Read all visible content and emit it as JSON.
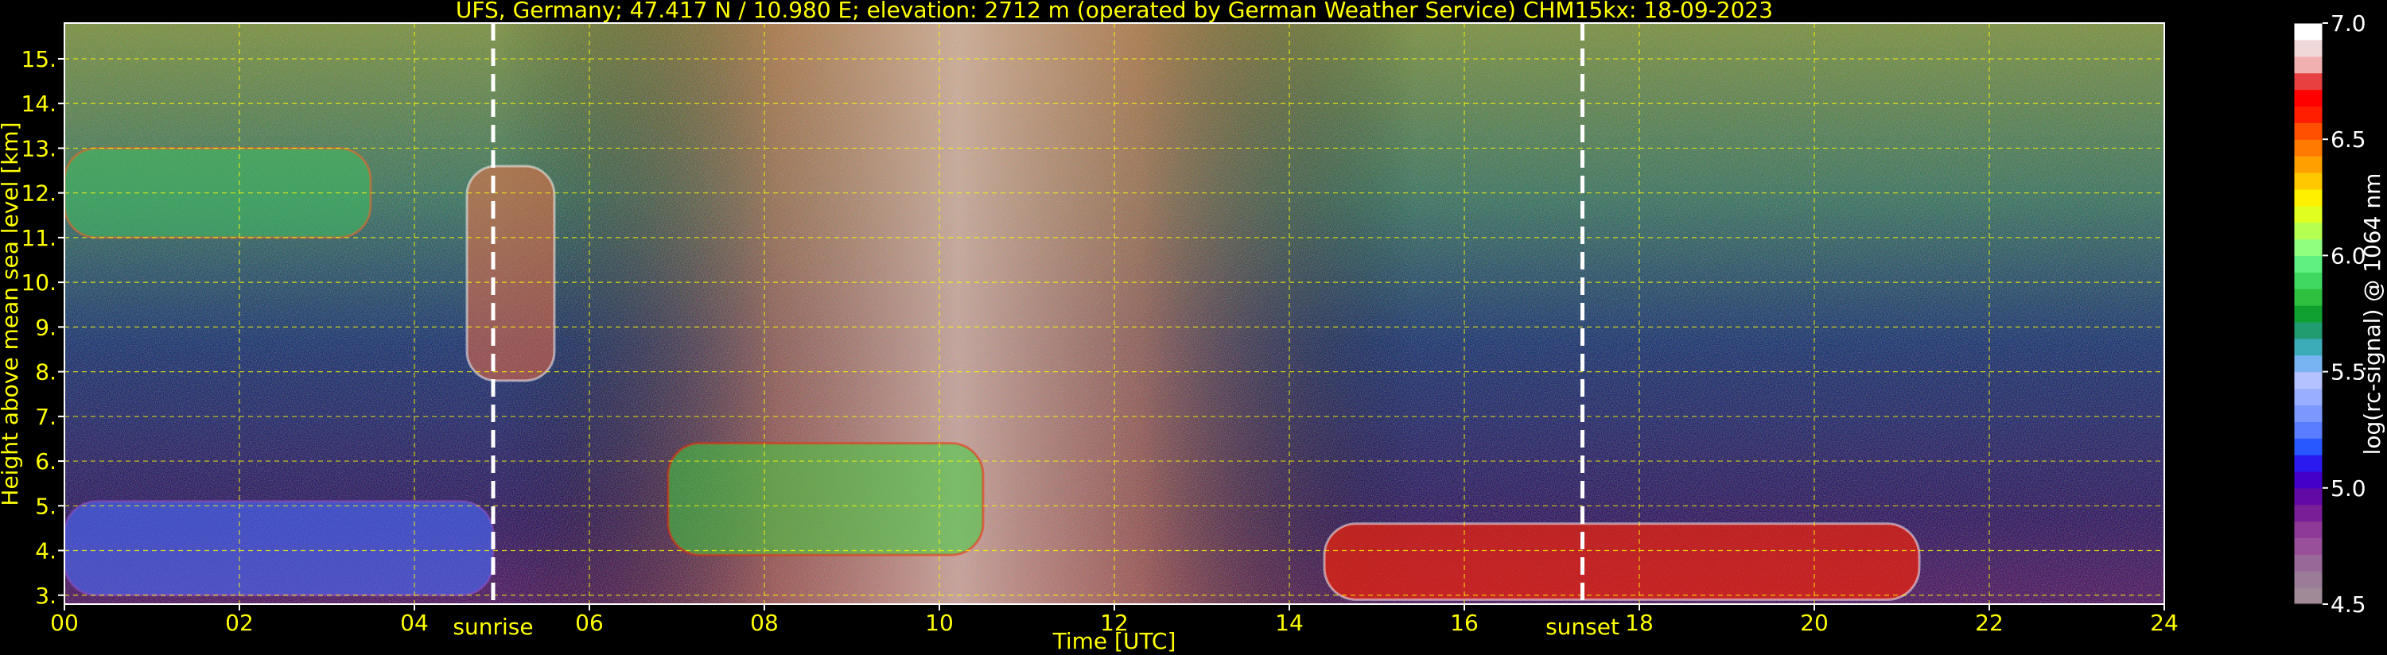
{
  "chart_data": {
    "type": "heatmap",
    "title": "UFS, Germany; 47.417 N / 10.980 E; elevation: 2712 m  (operated by German Weather Service)    CHM15kx: 18-09-2023",
    "xlabel": "Time [UTC]",
    "ylabel": "Height above mean sea level [km]",
    "xlim": [
      0,
      24
    ],
    "ylim": [
      2.8,
      15.8
    ],
    "xticks": [
      0,
      2,
      4,
      6,
      8,
      10,
      12,
      14,
      16,
      18,
      20,
      22,
      24
    ],
    "xtick_labels": [
      "00",
      "02",
      "04",
      "06",
      "08",
      "10",
      "12",
      "14",
      "16",
      "18",
      "20",
      "22",
      "24"
    ],
    "yticks": [
      3,
      4,
      5,
      6,
      7,
      8,
      9,
      10,
      11,
      12,
      13,
      14,
      15
    ],
    "ytick_labels": [
      "3.",
      "4.",
      "5.",
      "6.",
      "7.",
      "8.",
      "9.",
      "10.",
      "11.",
      "12.",
      "13.",
      "14.",
      "15."
    ],
    "grid": true,
    "annotations": [
      {
        "label": "sunrise",
        "x": 4.9
      },
      {
        "label": "sunset",
        "x": 17.35
      }
    ],
    "colorbar": {
      "label": "log(rc-signal) @ 1064 nm",
      "range": [
        4.5,
        7.0
      ],
      "ticks": [
        4.5,
        5.0,
        5.5,
        6.0,
        6.5,
        7.0
      ],
      "tick_labels": [
        "4.5",
        "5.0",
        "5.5",
        "6.0",
        "6.5",
        "7.0"
      ],
      "colors": [
        "#a08a98",
        "#9a7c98",
        "#986898",
        "#98509a",
        "#8e3a98",
        "#7a1e98",
        "#620aa6",
        "#4400c8",
        "#2a1af0",
        "#2858ff",
        "#5a7cff",
        "#7c98ff",
        "#9aaeff",
        "#b4c2ff",
        "#78b4f0",
        "#3cacb8",
        "#209c70",
        "#10a030",
        "#30c040",
        "#40d860",
        "#60f080",
        "#90ff80",
        "#b4ff50",
        "#e0ff20",
        "#fff000",
        "#ffc800",
        "#ffa000",
        "#ff7a00",
        "#ff5000",
        "#ff1e00",
        "#ff0000",
        "#e84040",
        "#f0b0b0",
        "#f0d8d8",
        "#ffffff"
      ]
    },
    "features": [
      {
        "kind": "cirrus",
        "x": [
          0.0,
          3.5
        ],
        "y": [
          11.0,
          13.0
        ]
      },
      {
        "kind": "cirrus-fallstreak",
        "x": [
          4.6,
          5.6
        ],
        "y": [
          7.8,
          12.6
        ]
      },
      {
        "kind": "elevated-layer",
        "x": [
          6.9,
          10.5
        ],
        "y": [
          3.9,
          6.4
        ]
      },
      {
        "kind": "low-cloud",
        "x": [
          14.4,
          21.2
        ],
        "y": [
          2.9,
          4.6
        ]
      },
      {
        "kind": "elevated-aerosol",
        "x": [
          0.0,
          4.9
        ],
        "y": [
          3.0,
          5.1
        ]
      }
    ]
  }
}
